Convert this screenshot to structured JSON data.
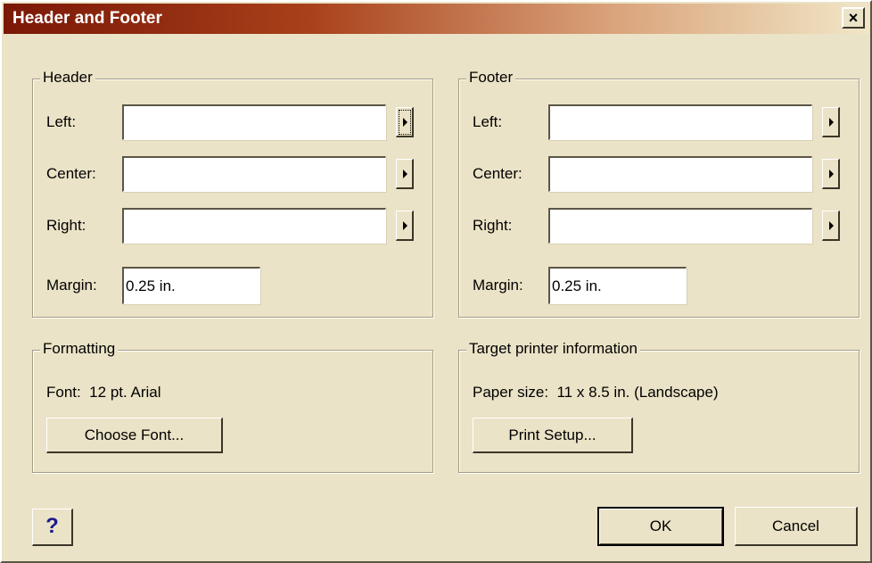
{
  "window": {
    "title": "Header and Footer",
    "close_label": "×"
  },
  "header": {
    "legend": "Header",
    "left_label": "Left:",
    "center_label": "Center:",
    "right_label": "Right:",
    "margin_label": "Margin:",
    "left_value": "",
    "center_value": "",
    "right_value": "",
    "margin_value": "0.25 in."
  },
  "footer": {
    "legend": "Footer",
    "left_label": "Left:",
    "center_label": "Center:",
    "right_label": "Right:",
    "margin_label": "Margin:",
    "left_value": "",
    "center_value": "",
    "right_value": "",
    "margin_value": "0.25 in."
  },
  "formatting": {
    "legend": "Formatting",
    "font_text": "Font:  12 pt. Arial",
    "choose_font_label": "Choose Font..."
  },
  "printer": {
    "legend": "Target printer information",
    "paper_text": "Paper size:  11 x 8.5 in. (Landscape)",
    "print_setup_label": "Print Setup..."
  },
  "buttons": {
    "help_label": "?",
    "ok_label": "OK",
    "cancel_label": "Cancel"
  }
}
